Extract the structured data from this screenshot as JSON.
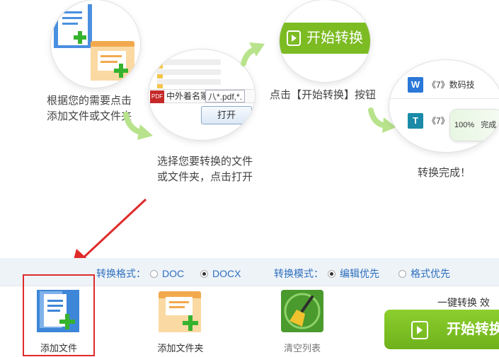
{
  "steps": {
    "step1": "根据您的需要点击添加文件或文件夹",
    "step1_line1": "根据您的需要点击",
    "step1_line2": "添加文件或文件夹",
    "step2_line1": "选择您要转换的文件",
    "step2_line2": "或文件夹，点击打开",
    "step3": "点击【开始转换】按钮",
    "step4": "转换完成！"
  },
  "dialog": {
    "pdf_badge": "PDF",
    "file_name": "中外着名冢",
    "file_filter": "八*.pdf,*.",
    "open_button": "打开"
  },
  "start_button_small": "开始转换",
  "results": {
    "doc1": "《7》数码技",
    "doc1_icon": "W",
    "doc2": "《7》",
    "doc2_icon": "T",
    "progress_percent": "100%",
    "progress_value": 1.0,
    "progress_status": "完成"
  },
  "options": {
    "format_label": "转换格式：",
    "format_doc": "DOC",
    "format_docx": "DOCX",
    "format_selected": "DOCX",
    "mode_label": "转换模式：",
    "mode_edit": "编辑优先",
    "mode_layout": "格式优先",
    "mode_selected": "编辑优先"
  },
  "toolbar": {
    "add_file": "添加文件",
    "add_folder": "添加文件夹",
    "clear_list": "清空列表",
    "quick_label": "一键转换  效",
    "start_button": "开始转换"
  },
  "colors": {
    "green": "#7cbb22",
    "blue_text": "#2d6fbd",
    "highlight_red": "#e02b2b"
  }
}
